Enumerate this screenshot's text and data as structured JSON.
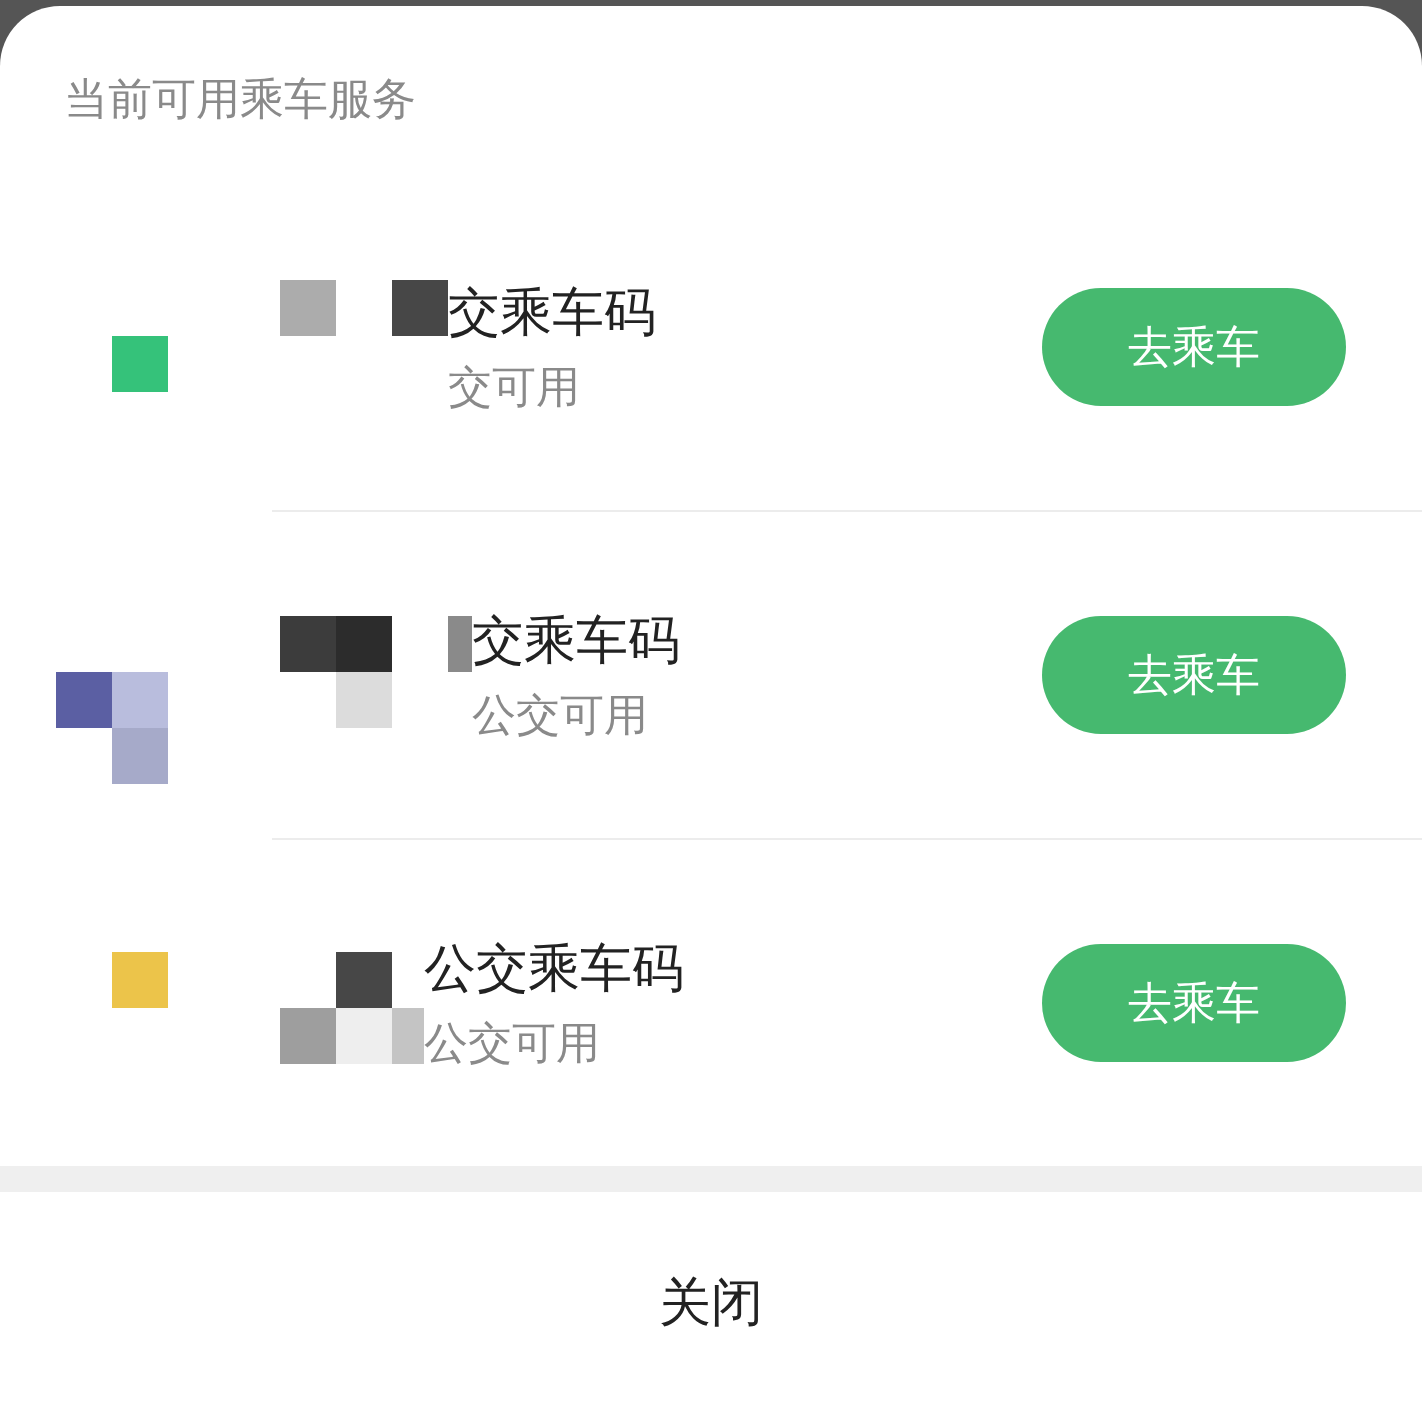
{
  "sheet": {
    "title": "当前可用乘车服务"
  },
  "services": [
    {
      "name": "交乘车码",
      "subtitle": "交可用",
      "button": "去乘车"
    },
    {
      "name": "交乘车码",
      "subtitle": "公交可用",
      "button": "去乘车"
    },
    {
      "name": "公交乘车码",
      "subtitle": "公交可用",
      "button": "去乘车"
    }
  ],
  "close_button": "关闭"
}
